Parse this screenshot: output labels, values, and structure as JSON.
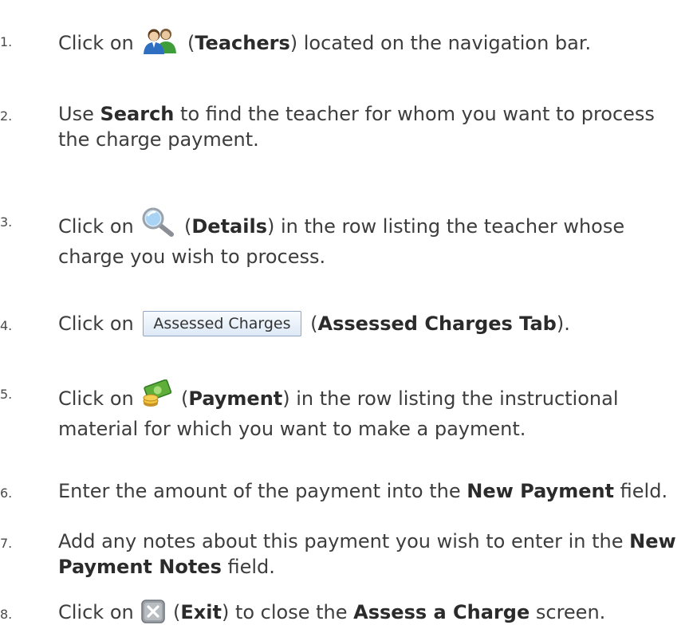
{
  "steps": [
    {
      "number": "1.",
      "pre": "Click on",
      "icon": "teachers-people-icon",
      "open": "(",
      "bold": "Teachers",
      "post": ") located on the navigation bar."
    },
    {
      "number": "2.",
      "pre": "Use",
      "bold": "Search",
      "post": "to find the teacher for whom you want to process the charge payment."
    },
    {
      "number": "3.",
      "pre": "Click on",
      "icon": "magnifier-details-icon",
      "open": "(",
      "bold": "Details",
      "post": ") in the row listing the teacher whose charge you wish to process."
    },
    {
      "number": "4.",
      "pre": "Click on",
      "button_label": "Assessed Charges",
      "open": "(",
      "bold": "Assessed Charges Tab",
      "post": ")."
    },
    {
      "number": "5.",
      "pre": "Click on",
      "icon": "money-coins-payment-icon",
      "open": "(",
      "bold": "Payment",
      "post": ") in the row listing the instructional material for which you want to make a payment."
    },
    {
      "number": "6.",
      "pre": "Enter the amount of the payment into the",
      "bold": "New Payment",
      "post": "field."
    },
    {
      "number": "7.",
      "pre": "Add any notes about this payment you wish to enter in the",
      "bold": "New Payment Notes",
      "post": "field."
    },
    {
      "number": "8.",
      "pre": "Click on",
      "icon": "close-x-exit-icon",
      "open": "(",
      "bold": "Exit",
      "mid": ") to close the",
      "bold2": "Assess a Charge",
      "post": "screen."
    }
  ]
}
